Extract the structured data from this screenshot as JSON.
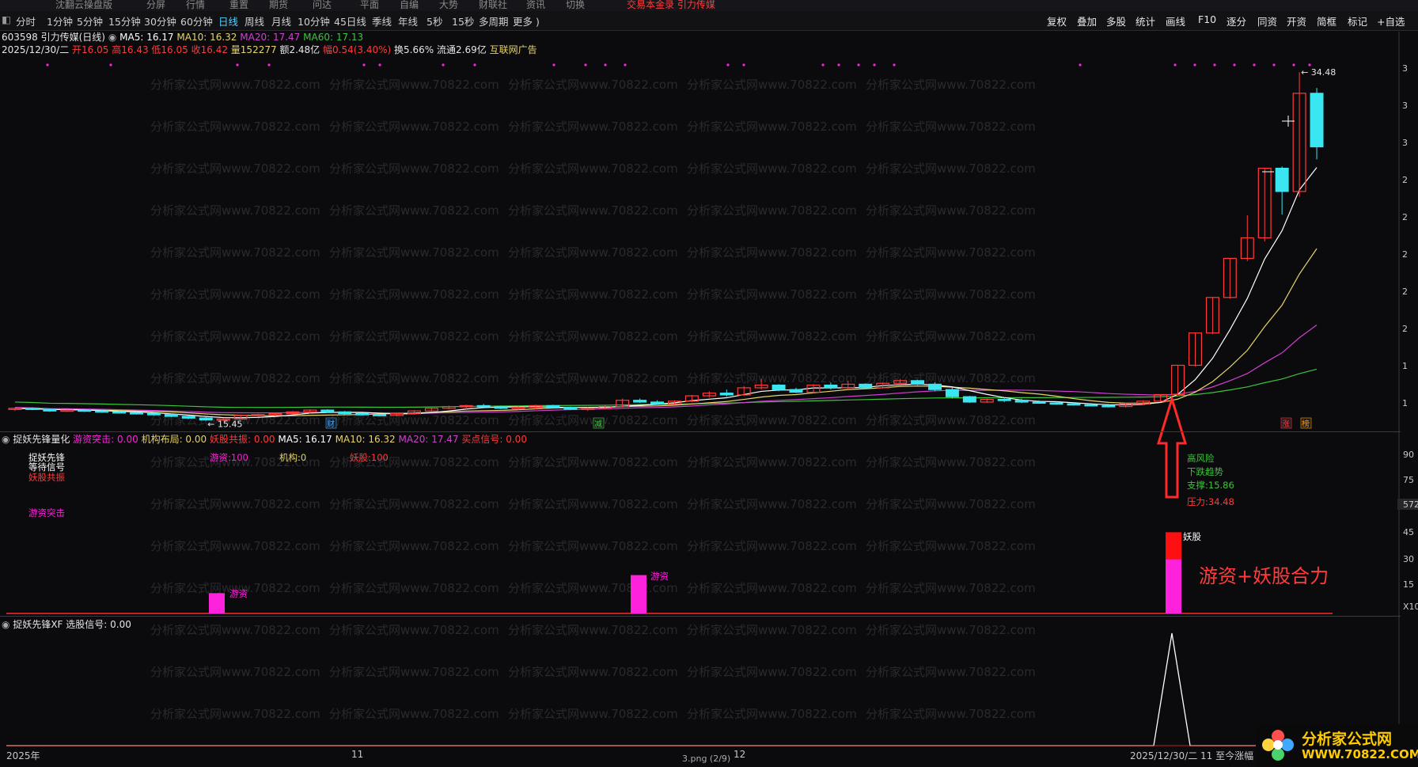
{
  "topbar": {
    "items": [
      "沈翻云操盘版",
      "分屏",
      "行情",
      "重置",
      "期货",
      "问达",
      "平面",
      "自编",
      "大势",
      "财联社",
      "资讯",
      "切换"
    ],
    "slogan": "交易本金录 引力传媒"
  },
  "toolbar": {
    "periods": [
      "分时",
      "1分钟",
      "5分钟",
      "15分钟",
      "30分钟",
      "60分钟",
      "日线",
      "周线",
      "月线",
      "10分钟",
      "45日线",
      "季线",
      "年线",
      "5秒",
      "15秒",
      "多周期",
      "更多 )"
    ],
    "active_period": "日线",
    "right_buttons": [
      "复权",
      "叠加",
      "多股",
      "统计",
      "画线",
      "F10",
      "逐分",
      "同资",
      "开资",
      "简框",
      "标记",
      "+自选"
    ]
  },
  "stock": {
    "title": "603598 引力传媒(日线)",
    "ma5": "MA5: 16.17",
    "ma10": "MA10: 16.32",
    "ma20": "MA20: 17.47",
    "ma60": "MA60: 17.13",
    "date": "2025/12/30/二",
    "open": "开16.05",
    "high": "高16.43",
    "low": "低16.05",
    "close": "收16.42",
    "volume": "量152277",
    "amount": "额2.48亿",
    "change": "幅0.54(3.40%)",
    "turnover": "换5.66%",
    "float": "流通2.69亿",
    "sector": "互联网广告",
    "high_label": "34.48",
    "low_label": "15.45",
    "markers": [
      "财",
      "减",
      "涨",
      "榜"
    ]
  },
  "price_scale": [
    "3",
    "3",
    "3",
    "2",
    "2",
    "2",
    "2",
    "2",
    "1",
    "1"
  ],
  "watermark": "分析家公式网www.70822.com",
  "indicator1": {
    "name": "捉妖先锋量化",
    "v1": "游资突击: 0.00",
    "v2": "机构布局: 0.00",
    "v3": "妖股共振: 0.00",
    "v4": "MA5: 16.17",
    "v5": "MA10: 16.32",
    "v6": "MA20: 17.47",
    "v7": "买点信号: 0.00",
    "legend": [
      "捉妖先锋",
      "等待信号",
      "妖股共振",
      "游资突击"
    ],
    "stats": [
      "游资:100",
      "机构:0",
      "妖股:100"
    ],
    "signal_text": [
      "高风险",
      "下跌趋势",
      "支撑:15.86",
      "压力:34.48"
    ],
    "bar_labels": [
      "游资",
      "游资",
      "妖股"
    ],
    "big_text": "游资+妖股合力",
    "scale": [
      "90",
      "75",
      "572",
      "45",
      "30",
      "15",
      "X10"
    ],
    "bars": [
      {
        "type": "游资",
        "value": 9
      },
      {
        "type": "游资",
        "value": 17
      },
      {
        "type": "合力",
        "value": 36,
        "top_value": 12
      }
    ]
  },
  "indicator2": {
    "name": "捉妖先锋XF",
    "v1": "选股信号: 0.00"
  },
  "xaxis": {
    "labels": [
      "2025年",
      "11",
      "3.png (2/9)",
      "12",
      "2025/12/30/二 11 至今涨幅"
    ]
  },
  "logo": {
    "line1": "分析家公式网",
    "line2": "WWW.70822.COM"
  },
  "colors": {
    "up": "#ff3b3b",
    "down": "#39e6f2",
    "ma5": "#ffffff",
    "ma10": "#e6d36b",
    "ma20": "#d040d0",
    "ma60": "#3cc43c",
    "magenta": "#ff22dd"
  },
  "chart_data": {
    "type": "candlestick",
    "candles": [
      [
        15.6,
        15.7,
        15.5,
        15.65
      ],
      [
        15.65,
        15.7,
        15.55,
        15.6
      ],
      [
        15.6,
        15.65,
        15.45,
        15.5
      ],
      [
        15.5,
        15.6,
        15.45,
        15.55
      ],
      [
        15.55,
        15.6,
        15.45,
        15.5
      ],
      [
        15.5,
        15.55,
        15.4,
        15.45
      ],
      [
        15.45,
        15.5,
        15.35,
        15.4
      ],
      [
        15.4,
        15.45,
        15.3,
        15.35
      ],
      [
        15.35,
        15.4,
        15.25,
        15.3
      ],
      [
        15.3,
        15.35,
        15.15,
        15.2
      ],
      [
        15.2,
        15.25,
        15.05,
        15.1
      ],
      [
        15.1,
        15.15,
        14.95,
        15.0
      ],
      [
        15.0,
        15.1,
        14.95,
        15.05
      ],
      [
        15.05,
        15.3,
        15.0,
        15.25
      ],
      [
        15.25,
        15.35,
        15.15,
        15.3
      ],
      [
        15.3,
        15.4,
        15.2,
        15.35
      ],
      [
        15.35,
        15.5,
        15.3,
        15.45
      ],
      [
        15.45,
        15.6,
        15.35,
        15.55
      ],
      [
        15.55,
        15.6,
        15.4,
        15.45
      ],
      [
        15.45,
        15.5,
        15.3,
        15.35
      ],
      [
        15.35,
        15.4,
        15.25,
        15.3
      ],
      [
        15.3,
        15.35,
        15.2,
        15.25
      ],
      [
        15.25,
        15.4,
        15.2,
        15.35
      ],
      [
        15.35,
        15.55,
        15.3,
        15.5
      ],
      [
        15.5,
        15.7,
        15.45,
        15.65
      ],
      [
        15.65,
        15.8,
        15.6,
        15.75
      ],
      [
        15.75,
        15.85,
        15.6,
        15.8
      ],
      [
        15.8,
        15.9,
        15.7,
        15.75
      ],
      [
        15.75,
        15.8,
        15.6,
        15.65
      ],
      [
        15.65,
        15.75,
        15.55,
        15.7
      ],
      [
        15.7,
        15.85,
        15.6,
        15.8
      ],
      [
        15.8,
        15.85,
        15.65,
        15.7
      ],
      [
        15.7,
        15.75,
        15.55,
        15.6
      ],
      [
        15.6,
        15.7,
        15.5,
        15.65
      ],
      [
        15.65,
        15.8,
        15.6,
        15.75
      ],
      [
        15.75,
        16.2,
        15.7,
        16.1
      ],
      [
        16.1,
        16.2,
        15.95,
        16.0
      ],
      [
        16.0,
        16.1,
        15.85,
        15.9
      ],
      [
        15.9,
        16.1,
        15.85,
        16.05
      ],
      [
        16.05,
        16.4,
        16.0,
        16.35
      ],
      [
        16.35,
        16.6,
        16.25,
        16.5
      ],
      [
        16.5,
        16.7,
        16.3,
        16.4
      ],
      [
        16.4,
        16.9,
        16.35,
        16.8
      ],
      [
        16.8,
        17.3,
        16.7,
        16.95
      ],
      [
        16.95,
        17.0,
        16.6,
        16.7
      ],
      [
        16.7,
        16.8,
        16.5,
        16.55
      ],
      [
        16.55,
        17.0,
        16.5,
        16.95
      ],
      [
        16.95,
        17.1,
        16.7,
        16.8
      ],
      [
        16.8,
        17.2,
        16.7,
        17.0
      ],
      [
        17.0,
        17.05,
        16.75,
        16.8
      ],
      [
        16.8,
        17.1,
        16.75,
        17.05
      ],
      [
        17.05,
        17.3,
        16.9,
        17.2
      ],
      [
        17.2,
        17.25,
        16.95,
        17.0
      ],
      [
        17.0,
        17.1,
        16.6,
        16.7
      ],
      [
        16.7,
        16.8,
        16.2,
        16.3
      ],
      [
        16.3,
        16.35,
        15.95,
        16.0
      ],
      [
        16.0,
        16.2,
        15.95,
        16.15
      ],
      [
        16.15,
        16.25,
        16.0,
        16.1
      ],
      [
        16.1,
        16.2,
        15.95,
        16.0
      ],
      [
        16.0,
        16.1,
        15.9,
        15.95
      ],
      [
        15.95,
        16.05,
        15.85,
        15.9
      ],
      [
        15.9,
        16.0,
        15.8,
        15.85
      ],
      [
        15.85,
        15.95,
        15.75,
        15.8
      ],
      [
        15.8,
        15.9,
        15.7,
        15.75
      ],
      [
        15.75,
        15.95,
        15.7,
        15.9
      ],
      [
        15.9,
        16.05,
        15.85,
        16.05
      ],
      [
        16.05,
        16.43,
        16.05,
        16.42
      ],
      [
        16.42,
        18.06,
        16.4,
        18.06
      ],
      [
        18.06,
        19.87,
        18.0,
        19.87
      ],
      [
        19.87,
        21.86,
        19.8,
        21.86
      ],
      [
        21.86,
        24.05,
        21.8,
        24.05
      ],
      [
        24.05,
        26.46,
        23.9,
        25.2
      ],
      [
        25.2,
        29.1,
        25.0,
        29.1
      ],
      [
        29.1,
        29.2,
        26.5,
        27.8
      ],
      [
        27.8,
        34.48,
        27.5,
        33.3
      ],
      [
        33.3,
        33.6,
        29.6,
        30.3
      ]
    ],
    "ylim": [
      14.8,
      35.2
    ]
  }
}
